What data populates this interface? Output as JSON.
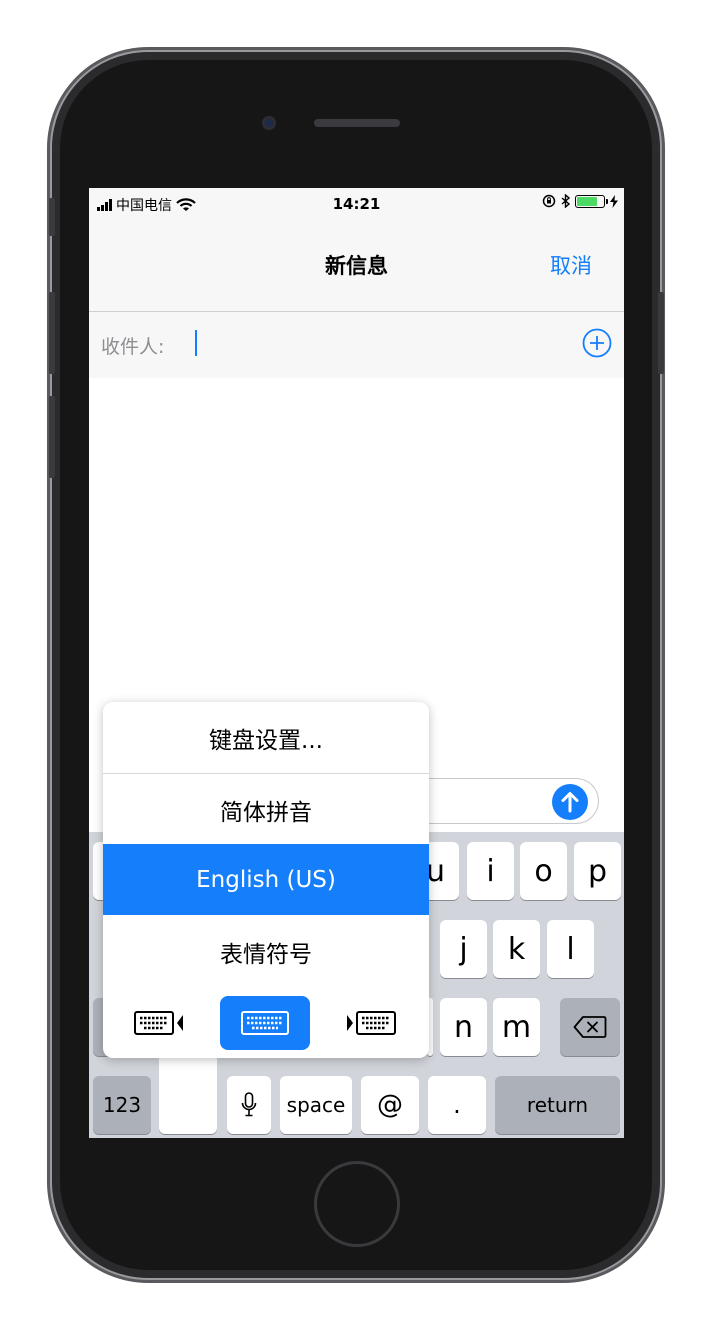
{
  "status_bar": {
    "carrier": "中国电信",
    "time": "14:21"
  },
  "nav": {
    "title": "新信息",
    "cancel_label": "取消"
  },
  "recipient": {
    "label": "收件人:"
  },
  "popup_menu": {
    "items": [
      "键盘设置...",
      "简体拼音",
      "English (US)",
      "表情符号"
    ],
    "selected_index": 2
  },
  "keyboard": {
    "row1_visible": [
      "u",
      "i",
      "o",
      "p"
    ],
    "row2_visible": [
      "j",
      "k",
      "l"
    ],
    "row3_visible": [
      "n",
      "m"
    ],
    "bottom": {
      "numbers_label": "123",
      "space_label": "space",
      "at_label": "@",
      "period_label": ".",
      "return_label": "return"
    }
  },
  "colors": {
    "accent": "#147efb",
    "battery": "#4cd964",
    "keyboard_bg": "#d1d4da"
  }
}
